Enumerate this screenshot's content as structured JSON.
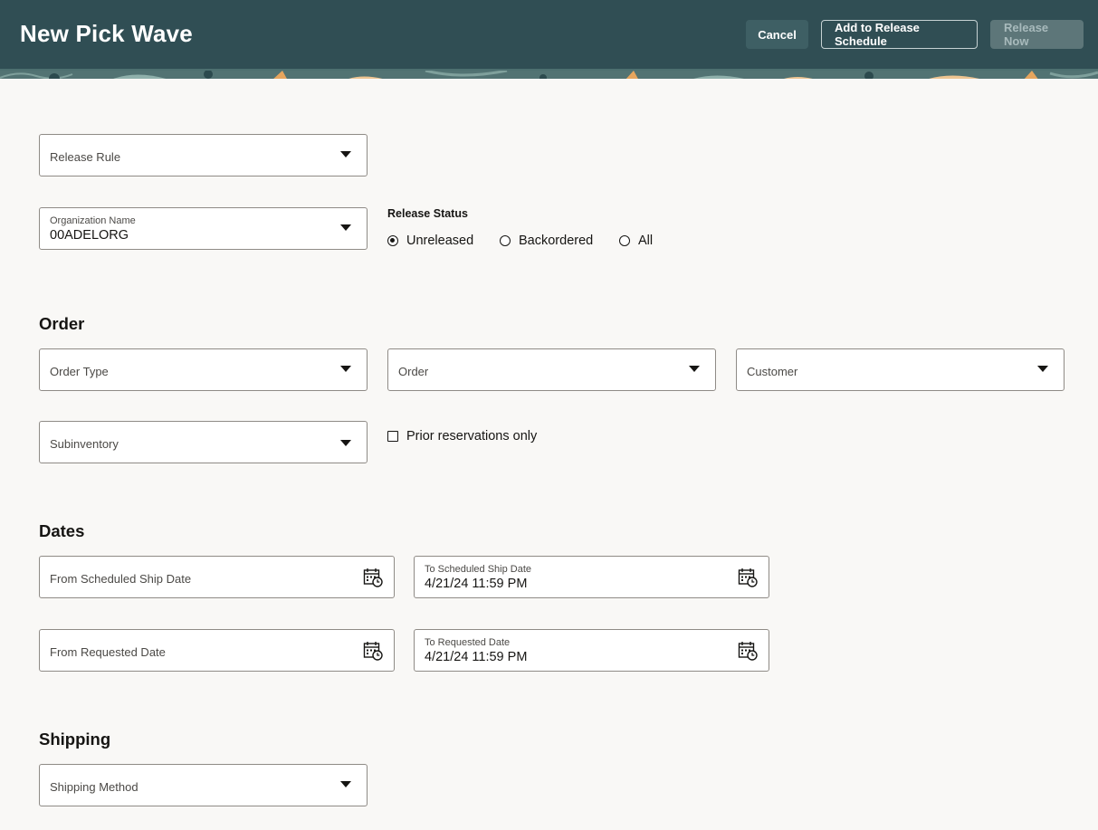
{
  "header": {
    "title": "New Pick Wave",
    "cancel_label": "Cancel",
    "add_schedule_label": "Add to Release Schedule",
    "release_now_label": "Release Now"
  },
  "general": {
    "release_rule": {
      "label": "Release Rule",
      "value": ""
    },
    "organization": {
      "label": "Organization Name",
      "value": "00ADELORG"
    },
    "release_status": {
      "label": "Release Status",
      "options": [
        "Unreleased",
        "Backordered",
        "All"
      ],
      "selected": "Unreleased"
    }
  },
  "order": {
    "title": "Order",
    "order_type": {
      "label": "Order Type"
    },
    "order": {
      "label": "Order"
    },
    "customer": {
      "label": "Customer"
    },
    "subinventory": {
      "label": "Subinventory"
    },
    "prior_reservations": {
      "label": "Prior reservations only",
      "checked": false
    }
  },
  "dates": {
    "title": "Dates",
    "from_scheduled_ship": {
      "label": "From Scheduled Ship Date",
      "value": ""
    },
    "to_scheduled_ship": {
      "label": "To Scheduled Ship Date",
      "value": "4/21/24 11:59 PM"
    },
    "from_requested": {
      "label": "From Requested Date",
      "value": ""
    },
    "to_requested": {
      "label": "To Requested Date",
      "value": "4/21/24 11:59 PM"
    }
  },
  "shipping": {
    "title": "Shipping",
    "shipping_method": {
      "label": "Shipping Method"
    }
  },
  "colors": {
    "header_bg": "#304e54",
    "page_bg": "#f9f8f6",
    "field_border": "#8f8b86"
  }
}
